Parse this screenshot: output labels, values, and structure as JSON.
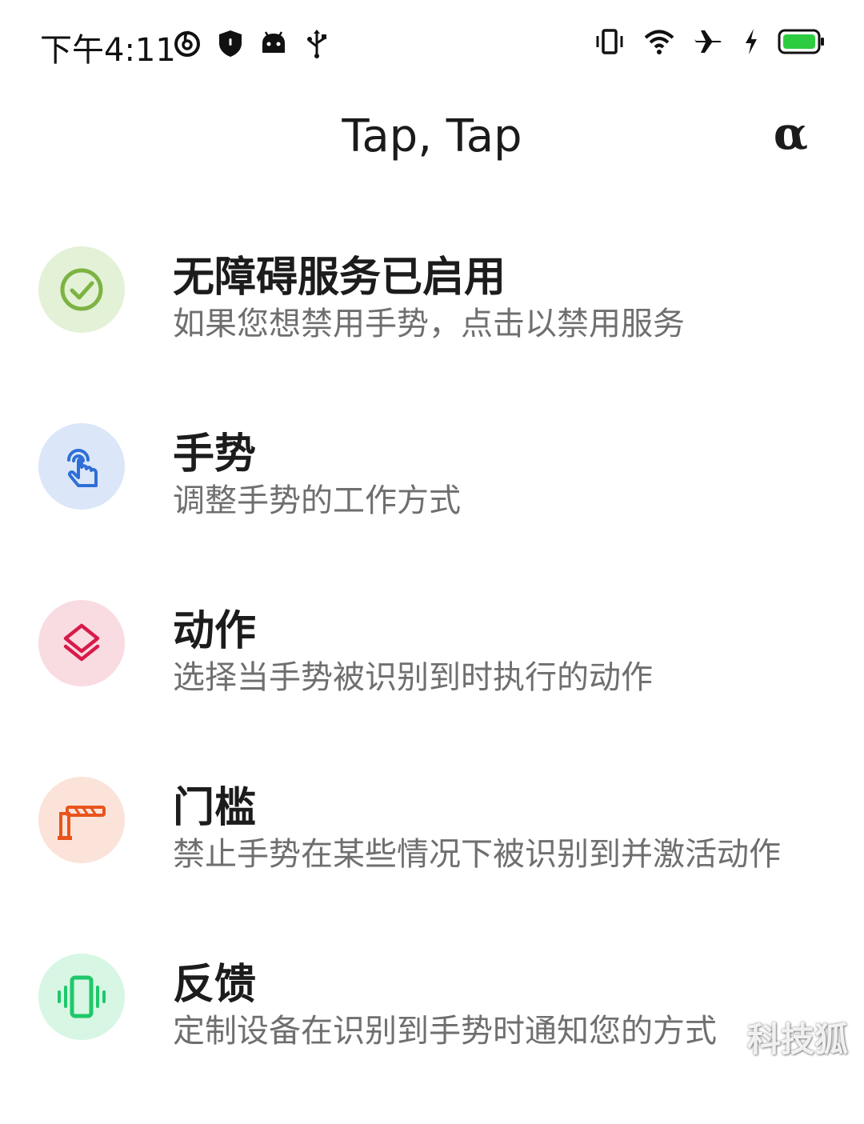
{
  "status_bar": {
    "time": "下午4:11",
    "left_icons": [
      "netease-music-icon",
      "shield-icon",
      "android-icon",
      "usb-icon"
    ],
    "right_icons": [
      "vibrate-icon",
      "wifi-icon",
      "airplane-icon",
      "charging-icon",
      "battery-icon"
    ],
    "battery_color": "#2ecc40"
  },
  "app_bar": {
    "title": "Tap, Tap",
    "alpha_label": "α"
  },
  "items": [
    {
      "title": "无障碍服务已启用",
      "subtitle": "如果您想禁用手势，点击以禁用服务",
      "icon": "check-circle-icon",
      "bg": "#e3f1d7",
      "fg": "#7cb342"
    },
    {
      "title": "手势",
      "subtitle": "调整手势的工作方式",
      "icon": "touch-gesture-icon",
      "bg": "#dbe7f8",
      "fg": "#2f6fd6"
    },
    {
      "title": "动作",
      "subtitle": "选择当手势被识别到时执行的动作",
      "icon": "layers-icon",
      "bg": "#f9dce2",
      "fg": "#d81b4a"
    },
    {
      "title": "门槛",
      "subtitle": "禁止手势在某些情况下被识别到并激活动作",
      "icon": "barrier-gate-icon",
      "bg": "#fbe3da",
      "fg": "#e8541c"
    },
    {
      "title": "反馈",
      "subtitle": "定制设备在识别到手势时通知您的方式",
      "icon": "vibration-icon",
      "bg": "#d8f6e4",
      "fg": "#1ec86a"
    }
  ],
  "watermark": "科技狐"
}
